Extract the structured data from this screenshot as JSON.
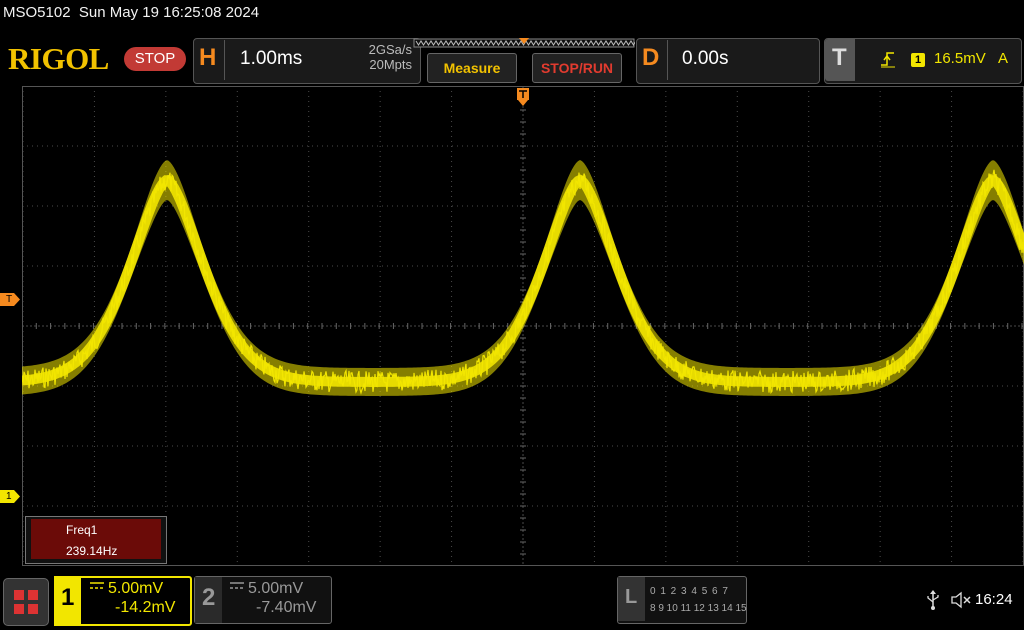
{
  "header": {
    "model": "MSO5102",
    "datetime": "Sun May 19 16:25:08 2024"
  },
  "brand": {
    "logo": "RIGOL",
    "run_state": "STOP"
  },
  "horizontal": {
    "letter": "H",
    "timebase": "1.00ms",
    "sample_rate": "2GSa/s",
    "memory_depth": "20Mpts"
  },
  "buttons": {
    "measure": "Measure",
    "stop_run": "STOP/RUN"
  },
  "delay": {
    "letter": "D",
    "value": "0.00s"
  },
  "trigger": {
    "letter": "T",
    "source": "1",
    "level": "16.5mV",
    "coupling": "A",
    "slope_icon": "rising-edge-icon"
  },
  "markers": {
    "trigger_marker": "T",
    "ch1_marker": "1"
  },
  "measurement": {
    "name": "Freq1",
    "value": "239.14Hz"
  },
  "channels": [
    {
      "number": "1",
      "scale": "5.00mV",
      "offset": "-14.2mV",
      "color": "#f2e600",
      "active": true,
      "coupling_icon": "dc-coupling-icon"
    },
    {
      "number": "2",
      "scale": "5.00mV",
      "offset": "-7.40mV",
      "color": "#999999",
      "active": false,
      "coupling_icon": "dc-coupling-icon"
    }
  ],
  "logic": {
    "letter": "L",
    "row1": "0 1 2 3  4 5 6 7",
    "row2": "8 9 10 11 12 13 14 15"
  },
  "status": {
    "time": "16:24",
    "icons": [
      "usb-icon",
      "speaker-muted-icon"
    ]
  },
  "colors": {
    "trace": "#f2e600",
    "trigger_orange": "#f58a1f",
    "logo_yellow": "#f2c200",
    "stop_red": "#c23a35",
    "freq_panel": "#6b0b08"
  }
}
